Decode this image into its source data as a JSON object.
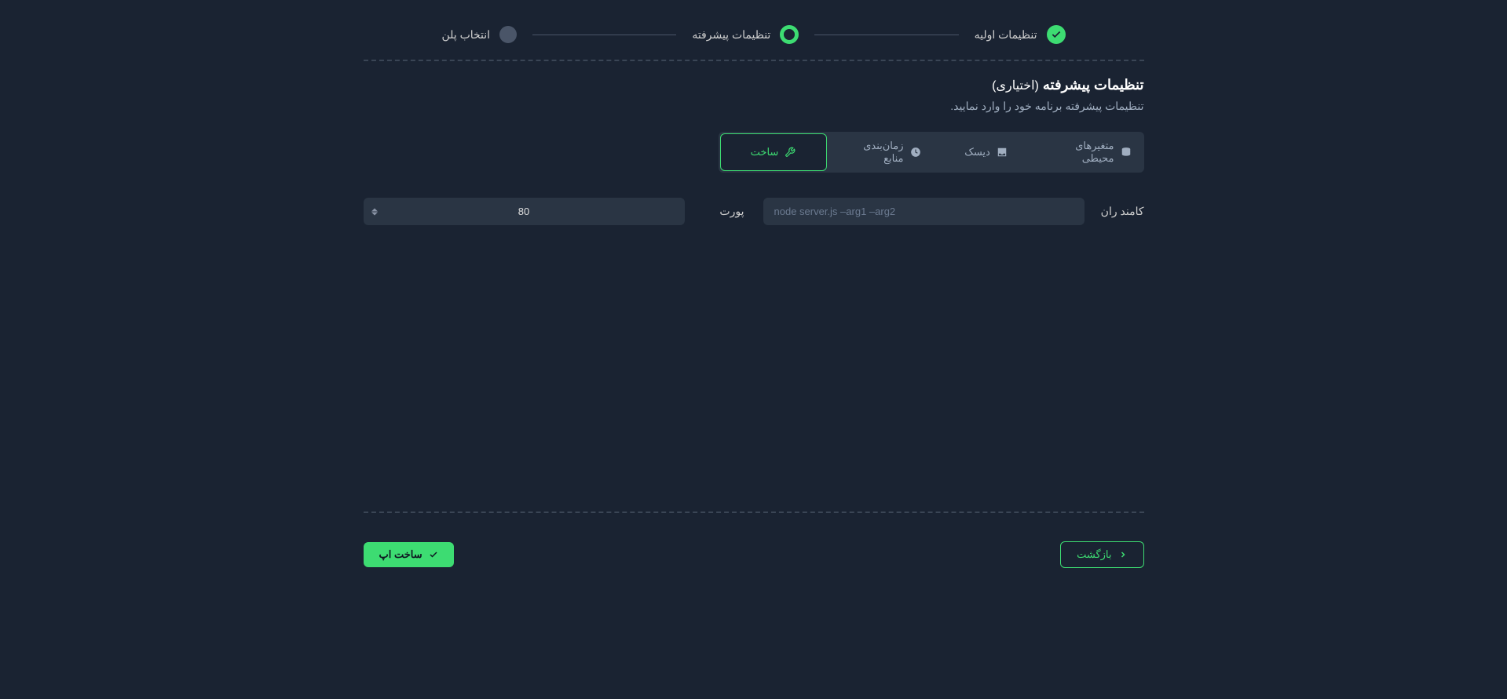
{
  "stepper": {
    "step1": "تنظیمات اولیه",
    "step2": "تنظیمات پیشرفته",
    "step3": "انتخاب پلن"
  },
  "section": {
    "title": "تنظیمات پیشرفته",
    "optional": "(اختیاری)",
    "subtitle": "تنظیمات پیشرفته برنامه خود را وارد نمایید."
  },
  "tabs": {
    "env": "متغیرهای محیطی",
    "disk": "دیسک",
    "schedule": "زمان‌بندی منابع",
    "build": "ساخت"
  },
  "form": {
    "runCommandLabel": "کامند ران",
    "runCommandPlaceholder": "node server.js –arg1 –arg2",
    "portLabel": "پورت",
    "portValue": "80"
  },
  "footer": {
    "back": "بازگشت",
    "create": "ساخت اپ"
  }
}
